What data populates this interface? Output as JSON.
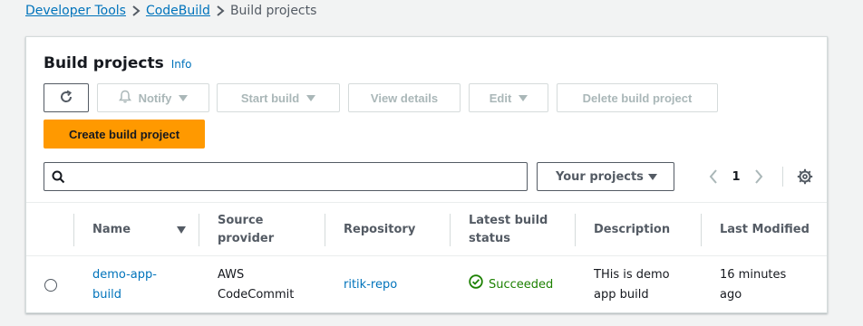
{
  "breadcrumb": {
    "items": [
      "Developer Tools",
      "CodeBuild"
    ],
    "current": "Build projects"
  },
  "panel": {
    "title": "Build projects",
    "info": "Info"
  },
  "actions": {
    "notify": "Notify",
    "start_build": "Start build",
    "view_details": "View details",
    "edit": "Edit",
    "delete": "Delete build project",
    "create": "Create build project"
  },
  "search": {
    "value": "",
    "placeholder": ""
  },
  "filter": {
    "selected": "Your projects"
  },
  "pagination": {
    "page": "1"
  },
  "table": {
    "columns": {
      "name": "Name",
      "source_provider": "Source provider",
      "repository": "Repository",
      "latest_build_status": "Latest build status",
      "description": "Description",
      "last_modified": "Last Modified"
    },
    "rows": [
      {
        "name": "demo-app-build",
        "source_provider": "AWS CodeCommit",
        "repository": "ritik-repo",
        "status": "Succeeded",
        "description": "THis is demo app build",
        "last_modified": "16 minutes ago"
      }
    ]
  },
  "colors": {
    "primary": "#ff9900",
    "link": "#0073bb",
    "success": "#1d8102",
    "disabled": "#aab7b8"
  },
  "icons": [
    "refresh-icon",
    "bell-icon",
    "search-icon",
    "chevron-left-icon",
    "chevron-right-icon",
    "gear-icon",
    "success-icon",
    "sort-down-icon"
  ]
}
